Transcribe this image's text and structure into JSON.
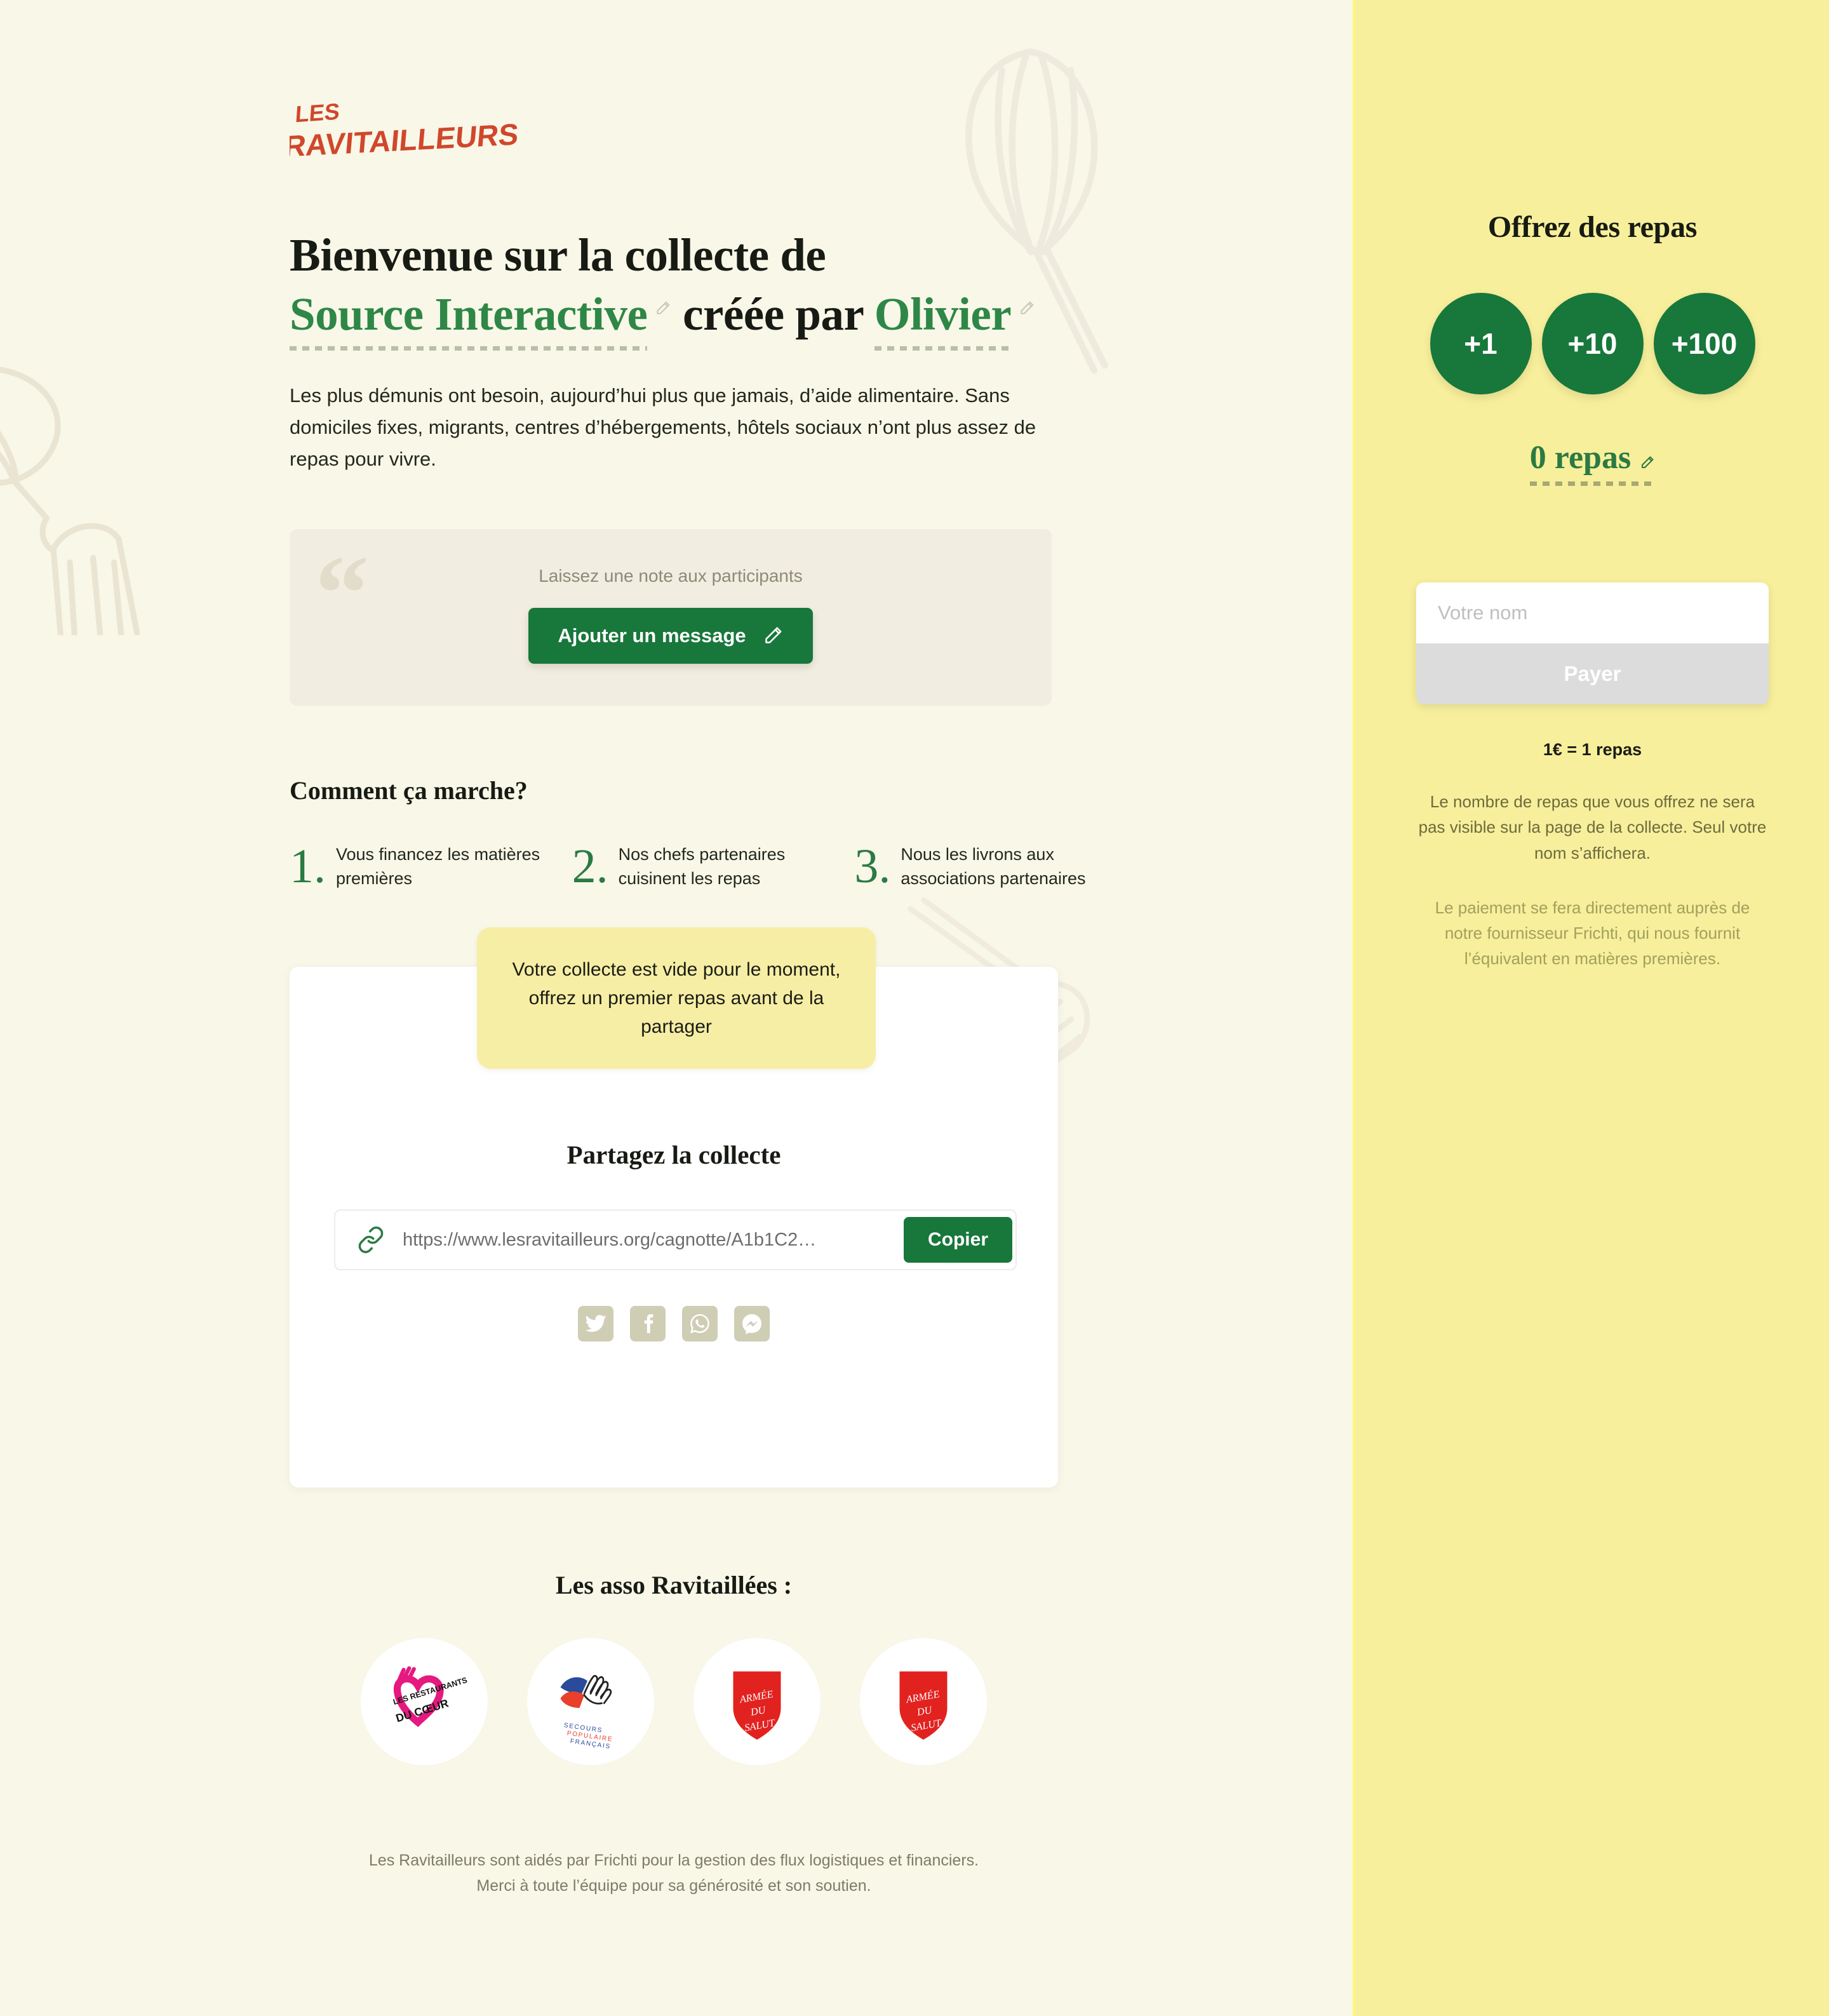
{
  "brand": {
    "logo_text_top": "LES",
    "logo_text_bottom": "RAVITAILLEURS",
    "accent_red": "#d0472b",
    "accent_green": "#18773b",
    "bg_cream": "#f8f7e8",
    "bg_yellow": "#f7ef9b"
  },
  "hero": {
    "line1": "Bienvenue sur la collecte de",
    "collect_name": "Source Interactive",
    "line2_mid": "créée par",
    "creator_name": "Olivier",
    "edit_icon": "pencil-icon",
    "paragraph": "Les plus démunis ont besoin, aujourd’hui plus que jamais, d’aide alimentaire. Sans domiciles fixes, migrants, centres d’hébergements, hôtels sociaux  n’ont plus assez de repas pour vivre."
  },
  "note_box": {
    "quote_glyph": "“",
    "label": "Laissez une note aux participants",
    "button_label": "Ajouter un message",
    "button_icon": "pencil-icon"
  },
  "how": {
    "title": "Comment ça marche?",
    "steps": [
      {
        "num": "1.",
        "text": "Vous financez les matières premières"
      },
      {
        "num": "2.",
        "text": "Nos chefs partenaires cuisinent les repas"
      },
      {
        "num": "3.",
        "text": "Nous les livrons aux associations partenaires"
      }
    ]
  },
  "share": {
    "tooltip": "Votre collecte est vide pour le moment, offrez un premier repas avant de la partager",
    "title": "Partagez la collecte",
    "url": "https://www.lesravitailleurs.org/cagnotte/A1b1C2…",
    "link_icon": "link-icon",
    "copy_label": "Copier",
    "socials": [
      {
        "name": "twitter-icon"
      },
      {
        "name": "facebook-icon"
      },
      {
        "name": "whatsapp-icon"
      },
      {
        "name": "messenger-icon"
      }
    ]
  },
  "assos": {
    "title": "Les asso Ravitaillées :",
    "items": [
      {
        "name": "restaurants-du-coeur-logo",
        "label": "LES RESTAURANTS DU CŒUR"
      },
      {
        "name": "secours-populaire-francais-logo",
        "label": "SECOURS POPULAIRE FRANÇAIS"
      },
      {
        "name": "armee-du-salut-logo",
        "label": "ARMÉE DU SALUT"
      },
      {
        "name": "armee-du-salut-logo-2",
        "label": "ARMÉE DU SALUT"
      }
    ]
  },
  "footer": {
    "line1": "Les Ravitailleurs sont aidés par Frichti pour la gestion des flux logistiques et financiers.",
    "line2": "Merci à toute l’équipe pour sa générosité et son soutien."
  },
  "sidebar": {
    "title": "Offrez des repas",
    "amounts": [
      {
        "label": "+1",
        "value": 1
      },
      {
        "label": "+10",
        "value": 10
      },
      {
        "label": "+100",
        "value": 100
      }
    ],
    "meals_count_label": "0 repas",
    "meals_edit_icon": "pencil-icon",
    "name_placeholder": "Votre nom",
    "name_value": "",
    "pay_label": "Payer",
    "rate": "1€ = 1 repas",
    "note_privacy": "Le nombre de repas que vous offrez ne sera pas visible sur la page de la collecte. Seul votre nom s’affichera.",
    "note_payment": "Le paiement se fera directement auprès de notre fournisseur Frichti, qui nous fournit l’équivalent en matières premières."
  }
}
